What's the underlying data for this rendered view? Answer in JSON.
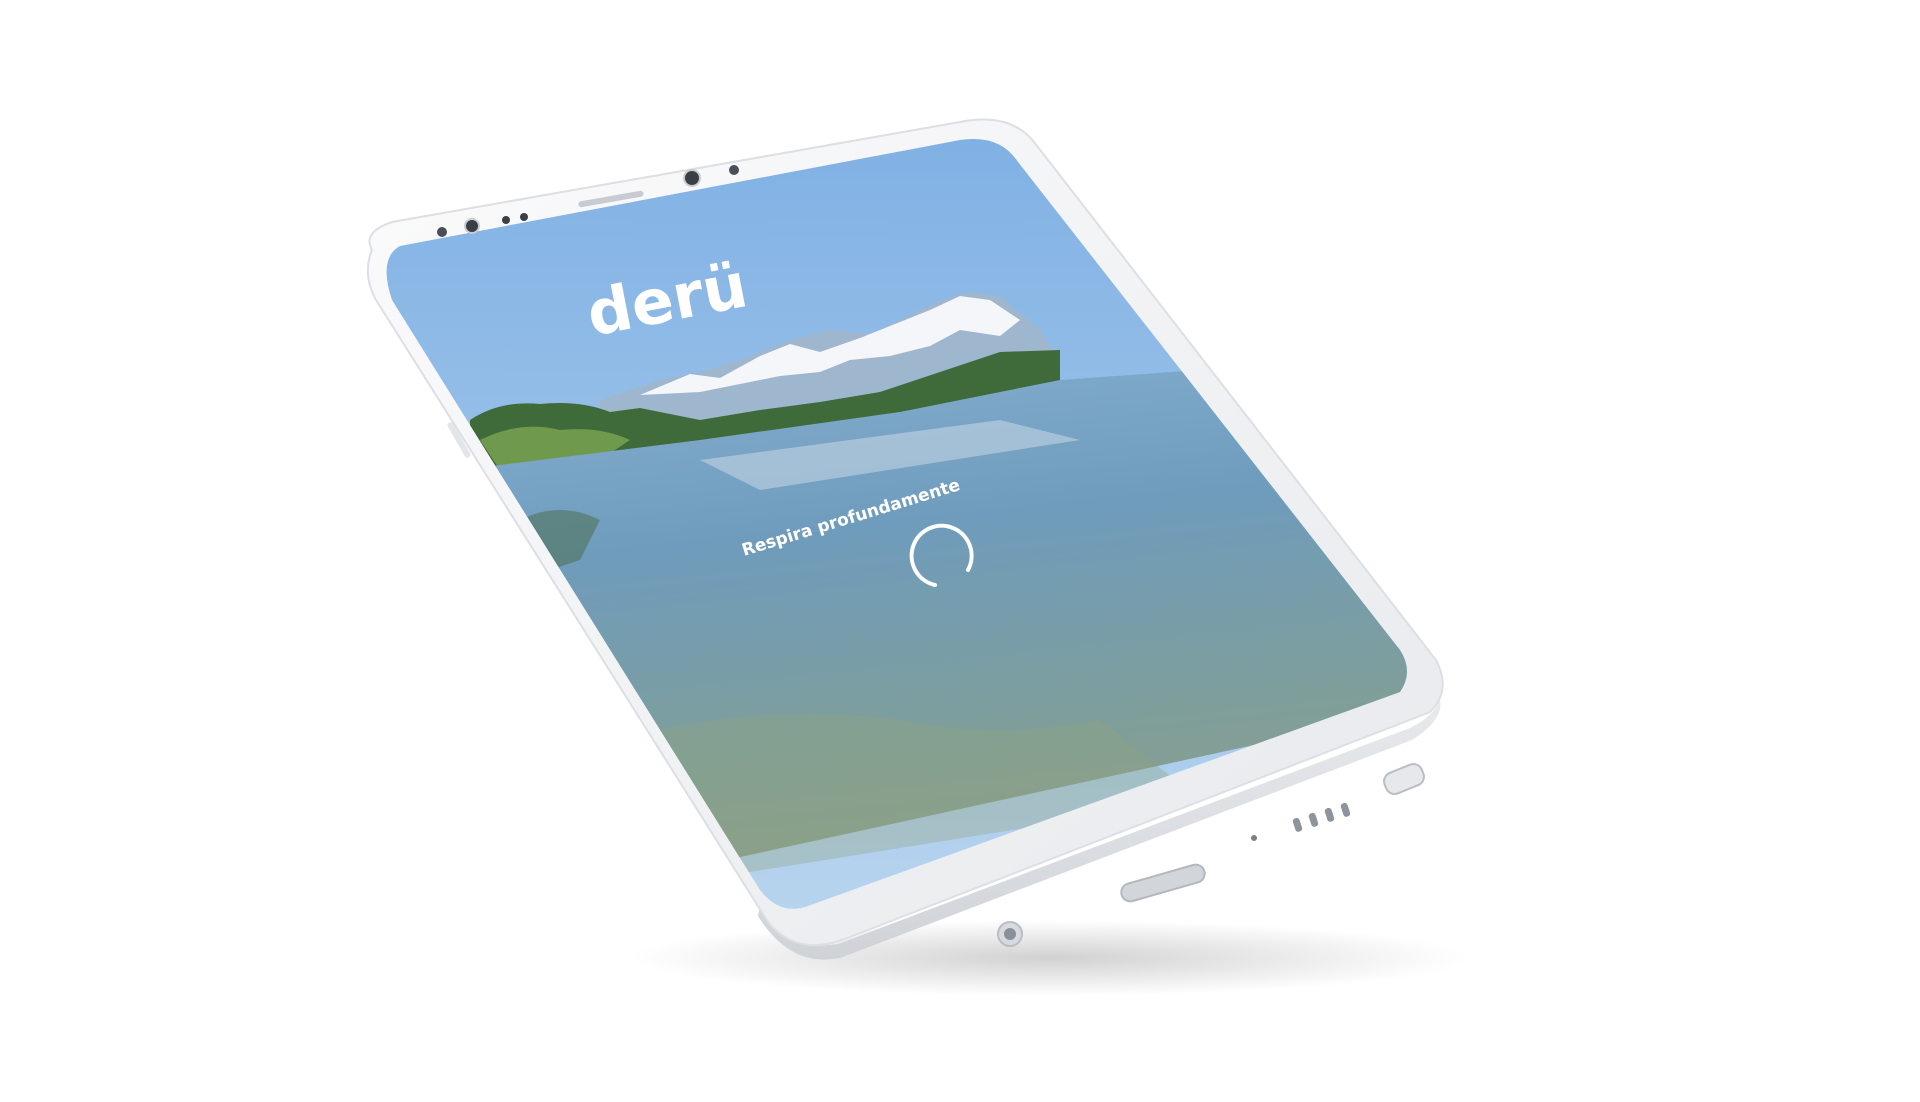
{
  "app": {
    "brand_name": "derü",
    "tagline": "Respira profundamente",
    "loading": true
  },
  "colors": {
    "sky": "#8fb9e6",
    "water": "#6f9fbf",
    "device_body": "#f2f3f5",
    "text": "#ffffff"
  },
  "icons": {
    "spinner": "loading-spinner-icon",
    "camera": "front-camera-icon",
    "speaker": "earpiece-speaker-icon",
    "usb_port": "usb-c-port-icon",
    "headphone_jack": "headphone-jack-icon"
  }
}
